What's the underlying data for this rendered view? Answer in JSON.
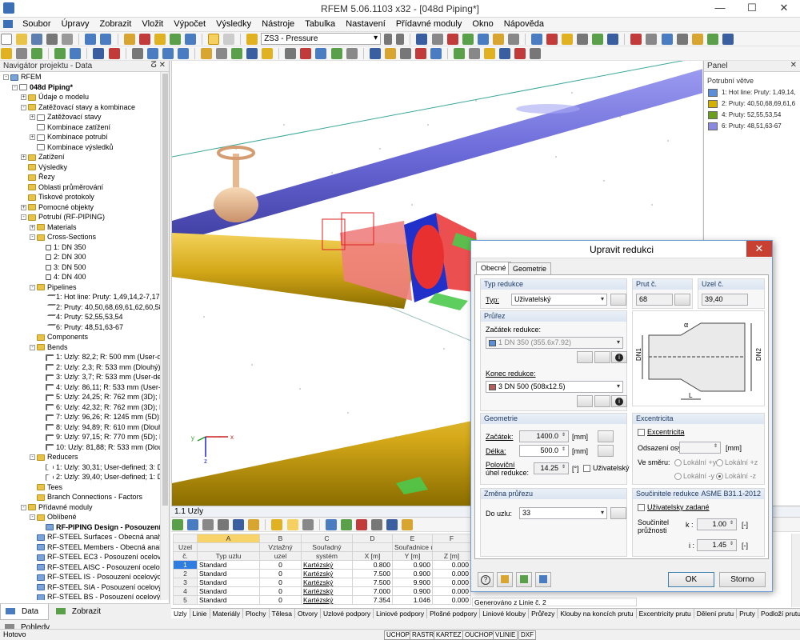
{
  "window": {
    "title": "RFEM 5.06.1103 x32 - [048d Piping*]",
    "minimize": "—",
    "maximize": "☐",
    "close": "✕"
  },
  "menu": [
    "Soubor",
    "Úpravy",
    "Zobrazit",
    "Vložit",
    "Výpočet",
    "Výsledky",
    "Nástroje",
    "Tabulka",
    "Nastavení",
    "Přídavné moduly",
    "Okno",
    "Nápověda"
  ],
  "toolbar": {
    "load_case_combo": "ZS3 - Pressure"
  },
  "navigator": {
    "title": "Navigátor projektu - Data",
    "pin": "ⵒ",
    "close": "✕",
    "tree": [
      {
        "label": "RFEM",
        "level": 0,
        "icon": "mod",
        "exp": "-"
      },
      {
        "label": "048d Piping*",
        "level": 1,
        "icon": "doc",
        "exp": "-",
        "bold": true
      },
      {
        "label": "Údaje o modelu",
        "level": 2,
        "icon": "folder",
        "exp": "+"
      },
      {
        "label": "Zatěžovací stavy a kombinace",
        "level": 2,
        "icon": "folder",
        "exp": "-"
      },
      {
        "label": "Zatěžovací stavy",
        "level": 3,
        "icon": "doc",
        "exp": "+"
      },
      {
        "label": "Kombinace zatížení",
        "level": 3,
        "icon": "doc",
        "exp": ""
      },
      {
        "label": "Kombinace potrubí",
        "level": 3,
        "icon": "doc",
        "exp": "+"
      },
      {
        "label": "Kombinace výsledků",
        "level": 3,
        "icon": "doc",
        "exp": ""
      },
      {
        "label": "Zatížení",
        "level": 2,
        "icon": "folder",
        "exp": "+"
      },
      {
        "label": "Výsledky",
        "level": 2,
        "icon": "folder",
        "exp": ""
      },
      {
        "label": "Řezy",
        "level": 2,
        "icon": "folder",
        "exp": ""
      },
      {
        "label": "Oblasti průměrování",
        "level": 2,
        "icon": "folder",
        "exp": ""
      },
      {
        "label": "Tiskové protokoly",
        "level": 2,
        "icon": "folder",
        "exp": ""
      },
      {
        "label": "Pomocné objekty",
        "level": 2,
        "icon": "folder",
        "exp": "+"
      },
      {
        "label": "Potrubí (RF-PIPING)",
        "level": 2,
        "icon": "folder",
        "exp": "-"
      },
      {
        "label": "Materials",
        "level": 3,
        "icon": "folder",
        "exp": "+"
      },
      {
        "label": "Cross-Sections",
        "level": 3,
        "icon": "folder",
        "exp": "-"
      },
      {
        "label": "1: DN 350",
        "level": 4,
        "icon": "circ",
        "exp": ""
      },
      {
        "label": "2: DN 300",
        "level": 4,
        "icon": "circ",
        "exp": ""
      },
      {
        "label": "3: DN 500",
        "level": 4,
        "icon": "circ",
        "exp": ""
      },
      {
        "label": "4: DN 400",
        "level": 4,
        "icon": "circ",
        "exp": ""
      },
      {
        "label": "Pipelines",
        "level": 3,
        "icon": "folder",
        "exp": "-"
      },
      {
        "label": "1: Hot line: Pruty: 1,49,14,2-7,17,16,",
        "level": 4,
        "icon": "pipe",
        "exp": ""
      },
      {
        "label": "2: Pruty: 40,50,68,69,61,62,60,58,59,4",
        "level": 4,
        "icon": "pipe",
        "exp": ""
      },
      {
        "label": "4: Pruty: 52,55,53,54",
        "level": 4,
        "icon": "pipe",
        "exp": ""
      },
      {
        "label": "6: Pruty: 48,51,63-67",
        "level": 4,
        "icon": "pipe",
        "exp": ""
      },
      {
        "label": "Components",
        "level": 3,
        "icon": "folder",
        "exp": ""
      },
      {
        "label": "Bends",
        "level": 3,
        "icon": "folder",
        "exp": "-"
      },
      {
        "label": "1: Uzly: 82,2; R: 500 mm (User-defin",
        "level": 4,
        "icon": "bnd",
        "exp": ""
      },
      {
        "label": "2: Uzly: 2,3; R: 533 mm (Dlouhý); AS",
        "level": 4,
        "icon": "bnd",
        "exp": ""
      },
      {
        "label": "3: Uzly: 3,7; R: 533 mm (User-define",
        "level": 4,
        "icon": "bnd",
        "exp": ""
      },
      {
        "label": "4: Uzly: 86,11; R: 533 mm (User-defi",
        "level": 4,
        "icon": "bnd",
        "exp": ""
      },
      {
        "label": "5: Uzly: 24,25; R: 762 mm (3D); EN 1",
        "level": 4,
        "icon": "bnd",
        "exp": ""
      },
      {
        "label": "6: Uzly: 42,32; R: 762 mm (3D); EN 1",
        "level": 4,
        "icon": "bnd",
        "exp": ""
      },
      {
        "label": "7: Uzly: 96,26; R: 1245 mm (5D); EN",
        "level": 4,
        "icon": "bnd",
        "exp": ""
      },
      {
        "label": "8: Uzly: 94,89; R: 610 mm (Dlouhý);",
        "level": 4,
        "icon": "bnd",
        "exp": ""
      },
      {
        "label": "9: Uzly: 97,15; R: 770 mm (5D); EN 1",
        "level": 4,
        "icon": "bnd",
        "exp": ""
      },
      {
        "label": "10: Uzly: 81,88; R: 533 mm (Dlouhý)",
        "level": 4,
        "icon": "bnd",
        "exp": ""
      },
      {
        "label": "Reducers",
        "level": 3,
        "icon": "folder",
        "exp": "-"
      },
      {
        "label": "1: Uzly: 30,31; User-defined; 3: DN 5",
        "level": 4,
        "icon": "red",
        "exp": ""
      },
      {
        "label": "2: Uzly: 39,40; User-defined; 1: DN 3",
        "level": 4,
        "icon": "red",
        "exp": ""
      },
      {
        "label": "Tees",
        "level": 3,
        "icon": "folder",
        "exp": ""
      },
      {
        "label": "Branch Connections - Factors",
        "level": 3,
        "icon": "folder",
        "exp": ""
      },
      {
        "label": "Přídavné moduly",
        "level": 2,
        "icon": "folder",
        "exp": "-"
      },
      {
        "label": "Oblíbené",
        "level": 3,
        "icon": "folder",
        "exp": "-"
      },
      {
        "label": "RF-PIPING Design - Posouzení po",
        "level": 4,
        "icon": "mod",
        "exp": "",
        "bold": true
      },
      {
        "label": "RF-STEEL Surfaces - Obecná analýza n",
        "level": 3,
        "icon": "mod",
        "exp": ""
      },
      {
        "label": "RF-STEEL Members - Obecná analýza r",
        "level": 3,
        "icon": "mod",
        "exp": ""
      },
      {
        "label": "RF-STEEL EC3 - Posouzení ocelových p",
        "level": 3,
        "icon": "mod",
        "exp": ""
      },
      {
        "label": "RF-STEEL AISC - Posouzení ocelových",
        "level": 3,
        "icon": "mod",
        "exp": ""
      },
      {
        "label": "RF-STEEL IS - Posouzení ocelových pr",
        "level": 3,
        "icon": "mod",
        "exp": ""
      },
      {
        "label": "RF-STEEL SIA - Posouzení ocelových p",
        "level": 3,
        "icon": "mod",
        "exp": ""
      },
      {
        "label": "RF-STEEL BS - Posouzení ocelových pr",
        "level": 3,
        "icon": "mod",
        "exp": ""
      }
    ],
    "tabs": [
      "Data",
      "Zobrazit",
      "Pohledy"
    ]
  },
  "panel": {
    "header": "Panel",
    "title": "Potrubní větve",
    "legend": [
      {
        "label": "1: Hot line: Pruty: 1,49,14,",
        "color": "#5b8fd8"
      },
      {
        "label": "2: Pruty: 40,50,68,69,61,6",
        "color": "#d4b000"
      },
      {
        "label": "4: Pruty: 52,55,53,54",
        "color": "#6a9e1f"
      },
      {
        "label": "6: Pruty: 48,51,63-67",
        "color": "#8b8ae0"
      }
    ]
  },
  "view3d": {
    "axis_x": "x",
    "axis_y": "y",
    "axis_z": "z"
  },
  "table": {
    "title": "1.1 Uzly",
    "col_letters": [
      "A",
      "B",
      "C",
      "D",
      "E",
      "F",
      "G"
    ],
    "h1": [
      "Uzel",
      "",
      "Vztažný",
      "Souřadný",
      "",
      "Souřadnice uzlu",
      "",
      ""
    ],
    "h2": [
      "č.",
      "Typ uzlu",
      "uzel",
      "systém",
      "X [m]",
      "Y [m]",
      "Z [m]",
      ""
    ],
    "rows": [
      [
        "1",
        "Standard",
        "0",
        "Kartézský",
        "0.800",
        "0.900",
        "0.000",
        ""
      ],
      [
        "2",
        "Standard",
        "0",
        "Kartézský",
        "7.500",
        "0.900",
        "0.000",
        ""
      ],
      [
        "3",
        "Standard",
        "0",
        "Kartézský",
        "7.500",
        "9.900",
        "0.000",
        ""
      ],
      [
        "4",
        "Standard",
        "0",
        "Kartézský",
        "7.000",
        "0.900",
        "0.000",
        ""
      ],
      [
        "5",
        "Standard",
        "0",
        "Kartézský",
        "7.354",
        "1.046",
        "0.000",
        "Generováno z Linie č. 2"
      ]
    ]
  },
  "bottom_tabs": [
    "Uzly",
    "Linie",
    "Materiály",
    "Plochy",
    "Tělesa",
    "Otvory",
    "Uzlové podpory",
    "Liniové podpory",
    "Plošné podpory",
    "Liniové klouby",
    "Průřezy",
    "Klouby na koncích prutu",
    "Excentricity prutu",
    "Dělení prutu",
    "Pruty",
    "Podloží prutu"
  ],
  "status": {
    "left": "Hotovo",
    "buttons": [
      "UCHOP",
      "RASTR",
      "KARTEZ",
      "OUCHOP",
      "VLINIE",
      "DXF"
    ]
  },
  "dialog": {
    "title": "Upravit redukci",
    "tabs": [
      "Obecné",
      "Geometrie"
    ],
    "typ_redukce": {
      "title": "Typ redukce",
      "label": "Typ:",
      "value": "Uživatelský"
    },
    "prut": {
      "title": "Prut č.",
      "value": "68"
    },
    "uzel": {
      "title": "Uzel č.",
      "value": "39,40"
    },
    "prurez": {
      "title": "Průřez",
      "start_label": "Začátek redukce:",
      "start_value": "1  DN 350 (355.6x7.92)",
      "end_label": "Konec redukce:",
      "end_value": "3  DN 500 (508x12.5)"
    },
    "geometrie": {
      "title": "Geometrie",
      "zacatek_label": "Začátek:",
      "zacatek_value": "1400.0",
      "zacatek_unit": "[mm]",
      "delka_label": "Délka:",
      "delka_value": "500.0",
      "delka_unit": "[mm]",
      "uhel_label1": "Poloviční",
      "uhel_label2": "úhel redukce:",
      "uhel_value": "14.25",
      "uhel_unit": "[°]",
      "uzivatelsky": "Uživatelský"
    },
    "excentricita": {
      "title": "Excentricita",
      "check": "Excentricita",
      "odsazeni_label": "Odsazení osy:",
      "odsazeni_unit": "[mm]",
      "smer_label": "Ve směru:",
      "radios": [
        "Lokální +y",
        "Lokální +z",
        "Lokální -y",
        "Lokální -z"
      ]
    },
    "zmena": {
      "title": "Změna průřezu",
      "label": "Do uzlu:",
      "value": "33"
    },
    "soucinitele": {
      "title": "Součinitele redukce",
      "standard": "ASME B31.1-2012",
      "check": "Uživatelsky zadané",
      "label1": "Součinitel",
      "label2": "průžnosti",
      "k_label": "k :",
      "k_value": "1.00",
      "i_label": "i :",
      "i_value": "1.45",
      "unit": "[-]"
    },
    "diagram": {
      "dn1": "DN1",
      "dn2": "DN2",
      "alpha": "α",
      "l": "L"
    },
    "ok": "OK",
    "cancel": "Storno"
  }
}
